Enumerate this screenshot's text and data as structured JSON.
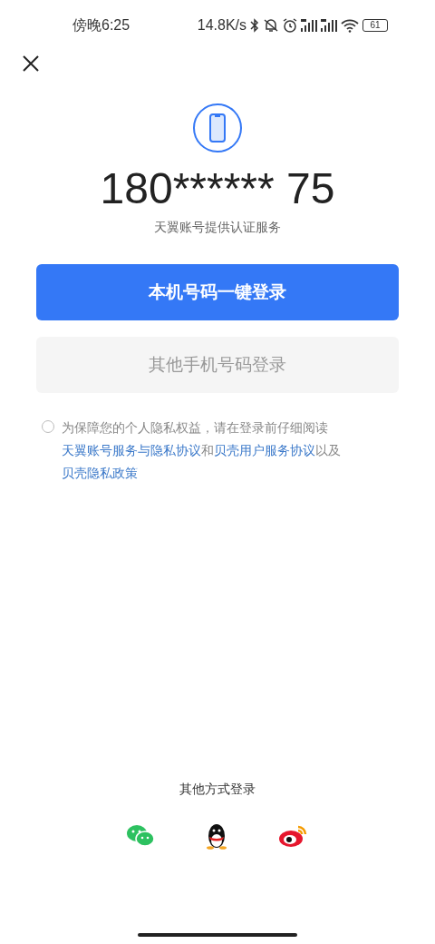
{
  "status_bar": {
    "time": "傍晚6:25",
    "speed": "14.8K/s",
    "battery": "61"
  },
  "phone": {
    "number": "180****** 75",
    "provider": "天翼账号提供认证服务"
  },
  "buttons": [
    {
      "label": "本机号码一键登录",
      "kind": "primary"
    },
    {
      "label": "其他手机号码登录",
      "kind": "secondary"
    }
  ],
  "agreement": {
    "checked": false,
    "segments": [
      {
        "kind": "text",
        "text": "为保障您的个人隐私权益，请在登录前仔细阅读"
      },
      {
        "kind": "link",
        "text": "天翼账号服务与隐私协议"
      },
      {
        "kind": "text",
        "text": "和"
      },
      {
        "kind": "link",
        "text": "贝壳用户服务协议"
      },
      {
        "kind": "text",
        "text": "以及"
      },
      {
        "kind": "link",
        "text": "贝壳隐私政策"
      }
    ]
  },
  "other_login": {
    "title": "其他方式登录",
    "options": [
      {
        "kind": "wechat"
      },
      {
        "kind": "qq"
      },
      {
        "kind": "weibo"
      }
    ]
  }
}
